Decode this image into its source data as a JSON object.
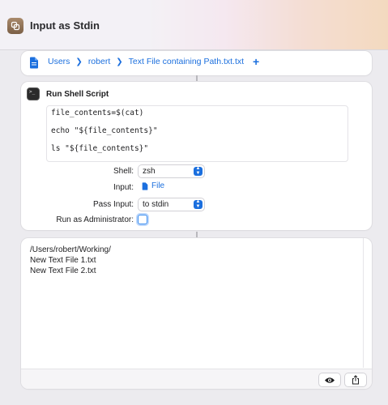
{
  "window": {
    "title": "Input as Stdin"
  },
  "colors": {
    "accent": "#1b6fde",
    "card_bg": "#ffffff",
    "window_bg": "#ecebef"
  },
  "file_action": {
    "icon": "document-icon",
    "path": [
      {
        "label": "Users"
      },
      {
        "label": "robert"
      },
      {
        "label": "Text File containing Path.txt.txt"
      }
    ],
    "add_label": "+"
  },
  "shell_action": {
    "icon": "terminal-icon",
    "title": "Run Shell Script",
    "script_lines": [
      "file_contents=$(cat)",
      "echo \"${file_contents}\"",
      "ls \"${file_contents}\""
    ],
    "shell": {
      "label": "Shell:",
      "value": "zsh"
    },
    "input": {
      "label": "Input:",
      "value": "File",
      "icon": "document-icon"
    },
    "pass_input": {
      "label": "Pass Input:",
      "value": "to stdin"
    },
    "run_as_admin": {
      "label": "Run as Administrator:",
      "checked": false
    }
  },
  "output": {
    "lines": [
      "/Users/robert/Working/",
      "New Text File 1.txt",
      "New Text File 2.txt"
    ],
    "buttons": [
      {
        "icon": "eye-icon"
      },
      {
        "icon": "share-icon"
      }
    ]
  }
}
